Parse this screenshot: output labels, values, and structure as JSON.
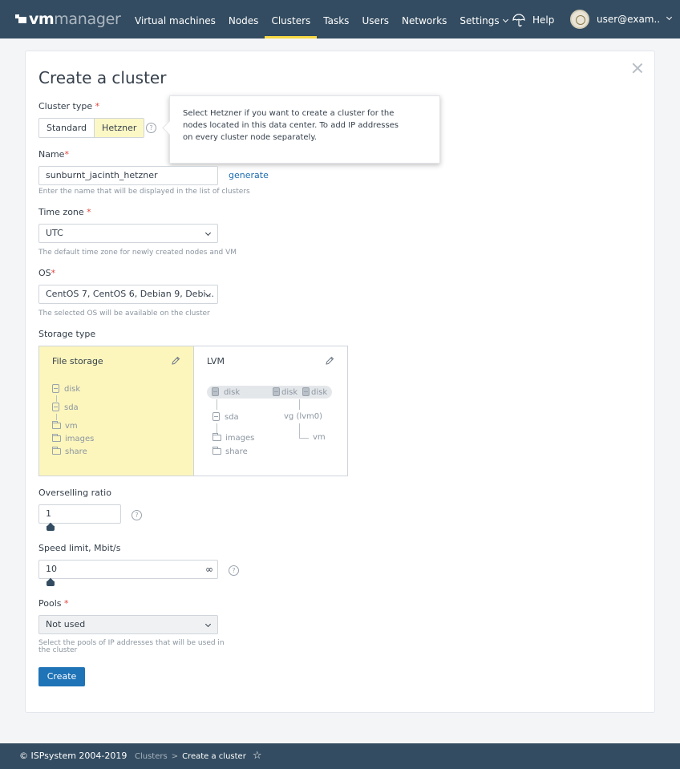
{
  "header": {
    "logo_bold": "vm",
    "logo_light": "manager",
    "nav": [
      {
        "label": "Virtual machines"
      },
      {
        "label": "Nodes"
      },
      {
        "label": "Clusters"
      },
      {
        "label": "Tasks"
      },
      {
        "label": "Users"
      },
      {
        "label": "Networks"
      },
      {
        "label": "Settings"
      }
    ],
    "active_nav": "Clusters",
    "help_label": "Help",
    "user_name": "user@exam..."
  },
  "form": {
    "title": "Create a cluster",
    "cluster_type": {
      "label": "Cluster type",
      "options": [
        "Standard",
        "Hetzner"
      ],
      "selected": "Hetzner"
    },
    "tooltip": {
      "line1": "Select Hetzner if you want to create a cluster for the",
      "line2": "nodes located in this data center. To add IP addresses",
      "line3": "on every cluster node separately."
    },
    "name": {
      "label": "Name",
      "value": "sunburnt_jacinth_hetzner",
      "generate_label": "generate",
      "hint": "Enter the name that will be displayed in the list of clusters"
    },
    "timezone": {
      "label": "Time zone",
      "value": "UTC",
      "hint": "The default time zone for newly created nodes and VM"
    },
    "os": {
      "label": "OS",
      "value": "CentOS 7, CentOS 6, Debian 9, Debi...",
      "hint": "The selected OS will be available on the cluster"
    },
    "storage": {
      "label": "Storage type",
      "selected": "File storage",
      "file": {
        "title": "File storage",
        "disk": "disk",
        "sda": "sda",
        "vm": "vm",
        "images": "images",
        "share": "share"
      },
      "lvm": {
        "title": "LVM",
        "disk": "disk",
        "sda": "sda",
        "vg": "vg",
        "vg_name": "(lvm0)",
        "vm": "vm",
        "images": "images",
        "share": "share"
      }
    },
    "overselling": {
      "label": "Overselling ratio",
      "value": "1"
    },
    "speed": {
      "label": "Speed limit, Mbit/s",
      "value": "10",
      "infinity": "∞"
    },
    "pools": {
      "label": "Pools",
      "value": "Not used",
      "hint_line1": "Select the pools of IP addresses that will be used in",
      "hint_line2": "the cluster"
    },
    "submit_label": "Create",
    "required_mark": "*"
  },
  "footer": {
    "copyright": "© ISPsystem 2004-2019",
    "crumb_parent": "Clusters",
    "crumb_sep": ">",
    "crumb_current": "Create a cluster",
    "star": "☆"
  },
  "colors": {
    "header_bg": "#334c61",
    "accent_yellow": "#f7d944",
    "selected_bg": "#fcf6bd",
    "primary_button": "#1f73b7",
    "link": "#1c6cb0",
    "required": "#e0453c"
  }
}
